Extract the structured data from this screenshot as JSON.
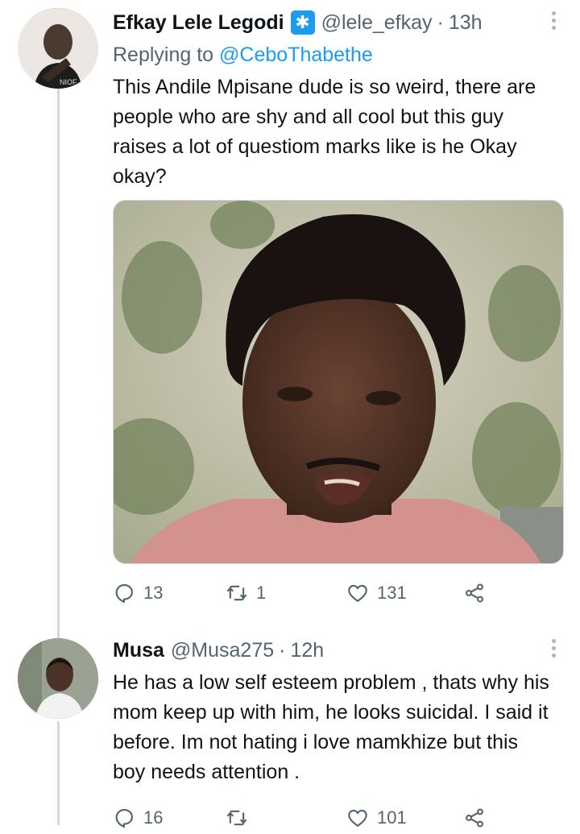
{
  "tweets": [
    {
      "author_name": "Efkay Lele Legodi",
      "badge_glyph": "✱",
      "handle": "@lele_efkay",
      "separator": "·",
      "time": "13h",
      "replying_prefix": "Replying to",
      "replying_to": "@CeboThabethe",
      "text": "This Andile Mpisane dude is so weird, there are people who are shy and all cool but this guy raises a lot of questiom marks like is he Okay okay?",
      "has_media": true,
      "media_icon": "photo-of-man",
      "reply_count": "13",
      "retweet_count": "1",
      "like_count": "131"
    },
    {
      "author_name": "Musa",
      "handle": "@Musa275",
      "separator": "·",
      "time": "12h",
      "text": "He has a low self esteem problem , thats why his mom keep up with him, he looks suicidal. I said it before. Im not hating i love mamkhize but this boy needs attention .",
      "reply_count": "16",
      "retweet_count": "",
      "like_count": "101"
    }
  ],
  "icons": {
    "reply": "reply-icon",
    "retweet": "retweet-icon",
    "like": "heart-icon",
    "share": "share-icon",
    "more": "more-vertical-icon"
  },
  "colors": {
    "text": "#0f1419",
    "secondary": "#536471",
    "accent": "#1d9bf0",
    "thread_line": "#cfd9de"
  }
}
